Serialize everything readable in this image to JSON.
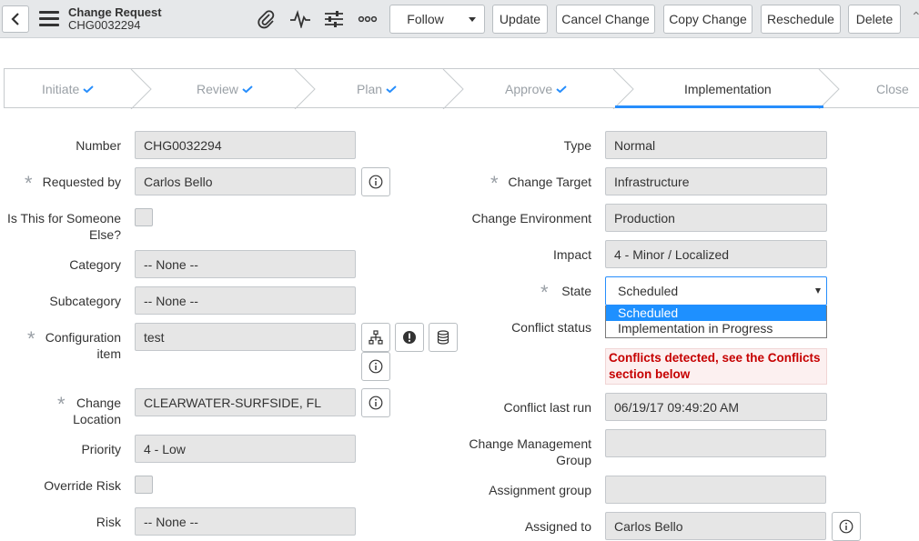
{
  "header": {
    "title": "Change Request",
    "number": "CHG0032294",
    "buttons": {
      "follow": "Follow",
      "update": "Update",
      "cancel_change": "Cancel Change",
      "copy_change": "Copy Change",
      "reschedule": "Reschedule",
      "delete": "Delete"
    },
    "icons": [
      "paperclip-icon",
      "activity-icon",
      "settings-icon",
      "more-icon"
    ]
  },
  "stages": [
    {
      "label": "Initiate",
      "state": "complete"
    },
    {
      "label": "Review",
      "state": "complete"
    },
    {
      "label": "Plan",
      "state": "complete"
    },
    {
      "label": "Approve",
      "state": "complete"
    },
    {
      "label": "Implementation",
      "state": "current"
    },
    {
      "label": "Close",
      "state": "pending"
    }
  ],
  "left": {
    "number": {
      "label": "Number",
      "value": "CHG0032294"
    },
    "requested_by": {
      "label": "Requested by",
      "value": "Carlos Bello",
      "required": true
    },
    "for_someone_else": {
      "label_line1": "Is This for Someone",
      "label_line2": "Else?"
    },
    "category": {
      "label": "Category",
      "value": "-- None --"
    },
    "subcategory": {
      "label": "Subcategory",
      "value": "-- None --"
    },
    "configuration_item": {
      "label_line1": "Configuration",
      "label_line2": "item",
      "value": "test",
      "required": true
    },
    "change_location": {
      "label_line1": "Change",
      "label_line2": "Location",
      "value": "CLEARWATER-SURFSIDE, FL",
      "required": true
    },
    "priority": {
      "label": "Priority",
      "value": "4 - Low"
    },
    "override_risk": {
      "label": "Override Risk"
    },
    "risk": {
      "label": "Risk",
      "value": "-- None --"
    }
  },
  "right": {
    "type": {
      "label": "Type",
      "value": "Normal"
    },
    "change_target": {
      "label": "Change Target",
      "value": "Infrastructure",
      "required": true
    },
    "change_environment": {
      "label": "Change Environment",
      "value": "Production"
    },
    "impact": {
      "label": "Impact",
      "value": "4 - Minor / Localized"
    },
    "state": {
      "label": "State",
      "value": "Scheduled",
      "required": true,
      "options": [
        "Scheduled",
        "Implementation in Progress"
      ]
    },
    "conflict_status": {
      "label": "Conflict status",
      "message_line1": "Conflicts detected, see the Conflicts",
      "message_line2": "section below"
    },
    "conflict_last_run": {
      "label": "Conflict last run",
      "value": "06/19/17 09:49:20 AM"
    },
    "change_management_group": {
      "label_line1": "Change Management",
      "label_line2": "Group",
      "value": ""
    },
    "assignment_group": {
      "label": "Assignment group",
      "value": ""
    },
    "assigned_to": {
      "label": "Assigned to",
      "value": "Carlos Bello"
    }
  },
  "colors": {
    "accent": "#278efc",
    "error": "#c60000",
    "selected_option": "#1e90ff"
  }
}
